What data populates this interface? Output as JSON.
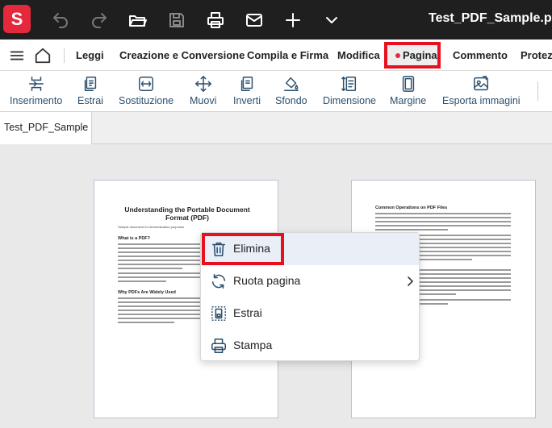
{
  "titlebar": {
    "logo_letter": "S",
    "document_title": "Test_PDF_Sample.pdf",
    "icons": [
      "undo-icon",
      "redo-icon",
      "open-folder-icon",
      "save-icon",
      "print-icon",
      "mail-icon",
      "add-icon",
      "chevron-down-icon"
    ]
  },
  "menubar": {
    "items": [
      "Leggi",
      "Creazione e Conversione",
      "Compila e Firma",
      "Modifica",
      "Pagina",
      "Commento",
      "Protezi"
    ],
    "active": "Pagina"
  },
  "toolbar": {
    "items": [
      {
        "label": "Inserimento",
        "icon": "insert-icon"
      },
      {
        "label": "Estrai",
        "icon": "extract-icon"
      },
      {
        "label": "Sostituzione",
        "icon": "replace-icon"
      },
      {
        "label": "Muovi",
        "icon": "move-icon"
      },
      {
        "label": "Inverti",
        "icon": "invert-icon"
      },
      {
        "label": "Sfondo",
        "icon": "background-icon"
      },
      {
        "label": "Dimensione",
        "icon": "size-icon"
      },
      {
        "label": "Margine",
        "icon": "margin-icon"
      },
      {
        "label": "Esporta immagini",
        "icon": "export-images-icon"
      }
    ]
  },
  "tabs": {
    "document_tab": "Test_PDF_Sample"
  },
  "pages": {
    "page1_title": "Understanding the Portable Document Format (PDF)",
    "page1_subtitle": "Sample document for demonstration purposes",
    "page1_h_what": "What is a PDF?",
    "page1_h_why": "Why PDFs Are Widely Used",
    "page2_h_ops": "Common Operations on PDF Files"
  },
  "context_menu": {
    "items": [
      {
        "label": "Elimina",
        "icon": "trash-icon"
      },
      {
        "label": "Ruota pagina",
        "icon": "rotate-icon"
      },
      {
        "label": "Estrai",
        "icon": "extract-page-icon"
      },
      {
        "label": "Stampa",
        "icon": "print-icon"
      }
    ]
  },
  "colors": {
    "accent": "#e5293d",
    "highlight_border": "#e8101e",
    "toolbar_text": "#2b4f6e",
    "titlebar_bg": "#1f1f1f"
  }
}
